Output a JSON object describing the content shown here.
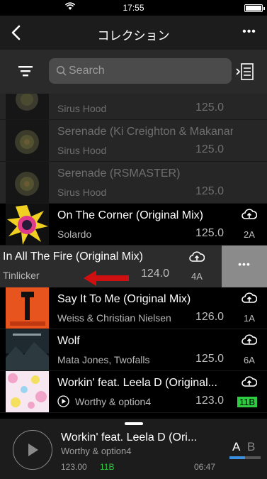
{
  "status_bar": {
    "time": "17:55"
  },
  "nav": {
    "title": "コレクション",
    "more": "•••"
  },
  "search": {
    "placeholder": "Search"
  },
  "tracks": [
    {
      "title": "",
      "artist": "Sirus Hood",
      "bpm": "125.0",
      "key": ""
    },
    {
      "title": "Serenade (Ki Creighton & Makanan...",
      "artist": "Sirus Hood",
      "bpm": "125.0",
      "key": ""
    },
    {
      "title": "Serenade (RSMASTER)",
      "artist": "Sirus Hood",
      "bpm": "125.0",
      "key": ""
    },
    {
      "title": "On The Corner (Original Mix)",
      "artist": "Solardo",
      "bpm": "125.0",
      "key": "2A"
    },
    {
      "title": "In All The Fire (Original Mix)",
      "artist": "Tinlicker",
      "bpm": "124.0",
      "key": "4A"
    },
    {
      "title": "Say It To Me (Original Mix)",
      "artist": "Weiss & Christian Nielsen",
      "bpm": "126.0",
      "key": "1A"
    },
    {
      "title": "Wolf",
      "artist": "Mata Jones, Twofalls",
      "bpm": "125.0",
      "key": "6A"
    },
    {
      "title": "Workin' feat. Leela D (Original...",
      "artist": "Worthy & option4",
      "bpm": "123.0",
      "key": "11B"
    }
  ],
  "swipe_action": {
    "more": "•••"
  },
  "player": {
    "title": "Workin' feat. Leela D (Ori...",
    "artist": "Worthy & option4",
    "bpm": "123.00",
    "key": "11B",
    "time": "06:47",
    "deck_a": "A",
    "deck_b": "B",
    "deck_progress": 0.5
  },
  "colors": {
    "key_highlight": "#2ecc40",
    "deck_accent": "#3b8fe0"
  },
  "icons": [
    "back-icon",
    "more-icon",
    "filter-icon",
    "search-icon",
    "list-view-icon",
    "cloud-upload-icon",
    "play-icon",
    "left-arrow-icon"
  ]
}
